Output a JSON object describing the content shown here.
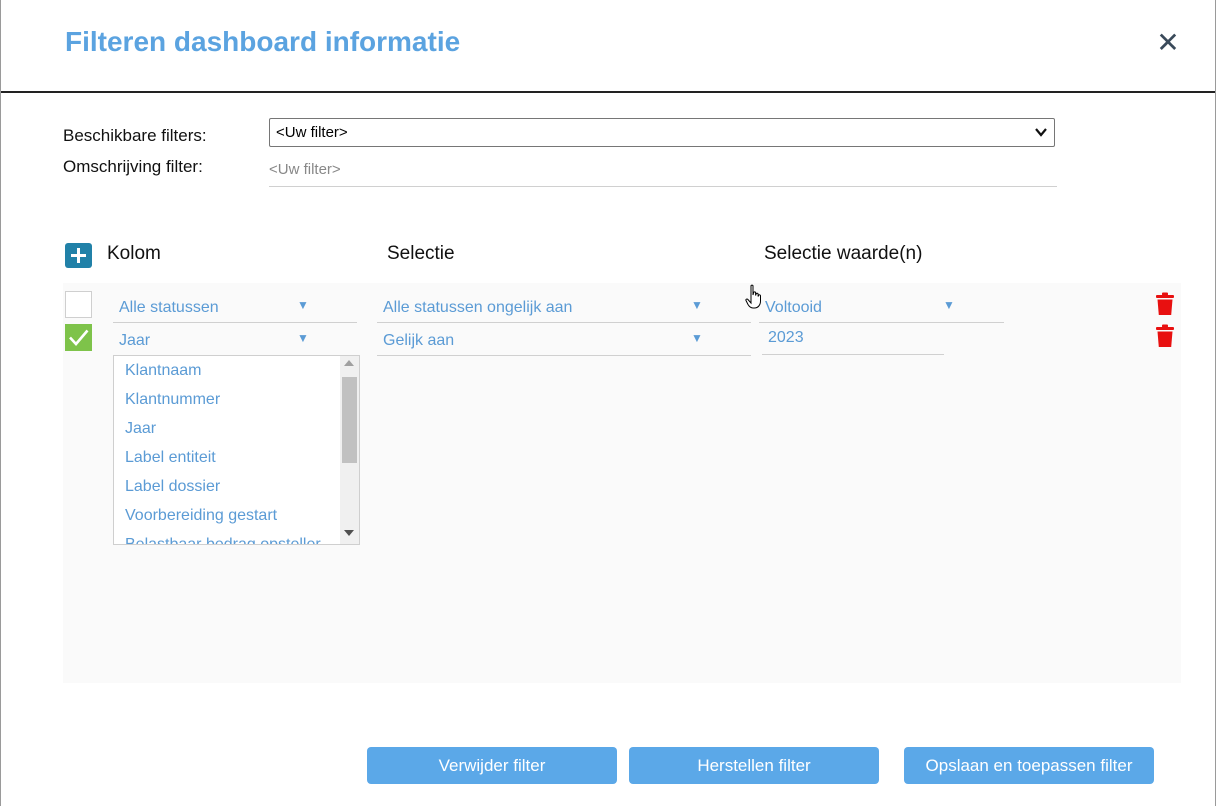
{
  "dialog": {
    "title": "Filteren dashboard informatie",
    "close_icon": "close-icon"
  },
  "filters": {
    "available_label": "Beschikbare filters:",
    "available_value": "<Uw filter>",
    "description_label": "Omschrijving filter:",
    "description_placeholder": "<Uw filter>"
  },
  "grid": {
    "headers": {
      "kolom": "Kolom",
      "selectie": "Selectie",
      "waarde": "Selectie waarde(n)"
    },
    "rows": [
      {
        "checked": false,
        "kolom": "Alle statussen",
        "selectie": "Alle statussen ongelijk aan",
        "waarde": "Voltooid",
        "waarde_type": "dropdown"
      },
      {
        "checked": true,
        "kolom": "Jaar",
        "selectie": "Gelijk aan",
        "waarde": "2023",
        "waarde_type": "input"
      }
    ]
  },
  "column_options": [
    "Klantnaam",
    "Klantnummer",
    "Jaar",
    "Label entiteit",
    "Label dossier",
    "Voorbereiding gestart",
    "Belastbaar bedrag opsteller"
  ],
  "buttons": {
    "delete": "Verwijder filter",
    "reset": "Herstellen filter",
    "save_apply": "Opslaan en toepassen filter"
  },
  "colors": {
    "title": "#5ba3e0",
    "link": "#5b9bd5",
    "button": "#5ba8e8",
    "add": "#2181a8",
    "check": "#7ec34a",
    "trash": "#e81010"
  }
}
